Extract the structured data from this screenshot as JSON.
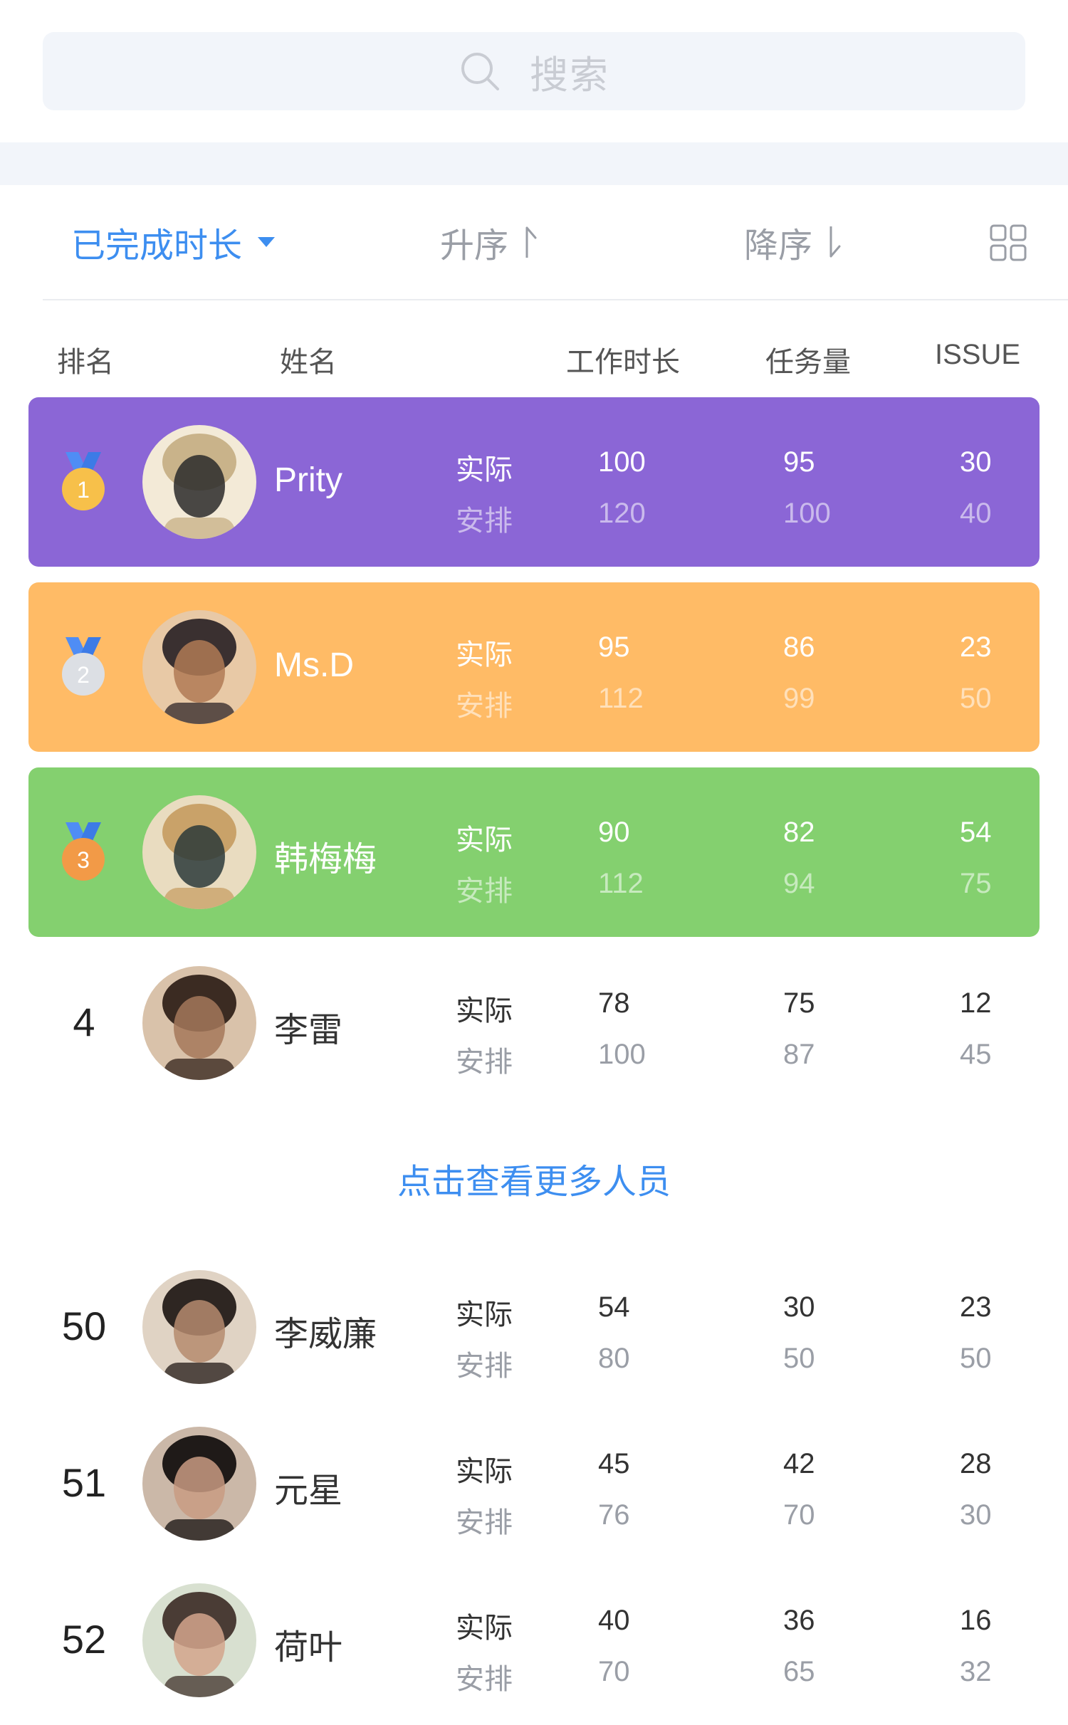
{
  "search": {
    "placeholder": "搜索"
  },
  "sortbar": {
    "field_label": "已完成时长",
    "asc_label": "升序",
    "desc_label": "降序",
    "accent_color": "#3d8ef0"
  },
  "header": {
    "rank": "排名",
    "name": "姓名",
    "hours": "工作时长",
    "tasks": "任务量",
    "issue": "ISSUE"
  },
  "labels": {
    "actual": "实际",
    "planned": "安排"
  },
  "rows": [
    {
      "rank": "1",
      "name": "Prity",
      "medal": "gold",
      "bg": "#8b66d6",
      "hours": [
        "100",
        "120"
      ],
      "tasks": [
        "95",
        "100"
      ],
      "issue": [
        "30",
        "40"
      ]
    },
    {
      "rank": "2",
      "name": "Ms.D",
      "medal": "silver",
      "bg": "#ffbb66",
      "hours": [
        "95",
        "112"
      ],
      "tasks": [
        "86",
        "99"
      ],
      "issue": [
        "23",
        "50"
      ]
    },
    {
      "rank": "3",
      "name": "韩梅梅",
      "medal": "bronze",
      "bg": "#84d06f",
      "hours": [
        "90",
        "112"
      ],
      "tasks": [
        "82",
        "94"
      ],
      "issue": [
        "54",
        "75"
      ]
    },
    {
      "rank": "4",
      "name": "李雷",
      "hours": [
        "78",
        "100"
      ],
      "tasks": [
        "75",
        "87"
      ],
      "issue": [
        "12",
        "45"
      ]
    },
    {
      "rank": "50",
      "name": "李威廉",
      "hours": [
        "54",
        "80"
      ],
      "tasks": [
        "30",
        "50"
      ],
      "issue": [
        "23",
        "50"
      ]
    },
    {
      "rank": "51",
      "name": "元星",
      "hours": [
        "45",
        "76"
      ],
      "tasks": [
        "42",
        "70"
      ],
      "issue": [
        "28",
        "30"
      ]
    },
    {
      "rank": "52",
      "name": "荷叶",
      "hours": [
        "40",
        "70"
      ],
      "tasks": [
        "36",
        "65"
      ],
      "issue": [
        "16",
        "32"
      ]
    }
  ],
  "more_link": "点击查看更多人员",
  "icons": {
    "search": "search-icon",
    "asc": "arrow-up-icon",
    "desc": "arrow-down-icon",
    "grid": "grid-view-icon",
    "medal": "medal-icon",
    "avatar": "avatar"
  }
}
